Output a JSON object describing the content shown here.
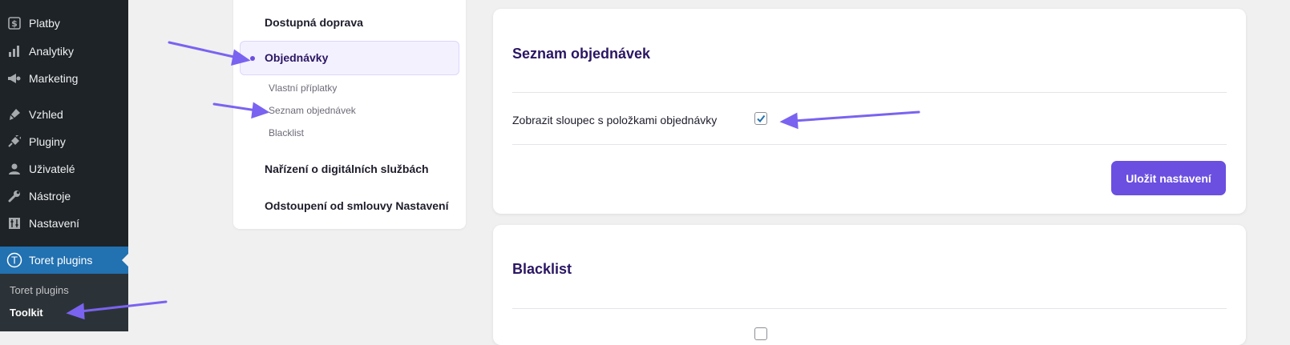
{
  "sidebar": {
    "items": [
      {
        "label": "Platby",
        "icon": "dollar-icon"
      },
      {
        "label": "Analytiky",
        "icon": "bar-chart-icon"
      },
      {
        "label": "Marketing",
        "icon": "megaphone-icon"
      },
      {
        "label": "Vzhled",
        "icon": "paintbrush-icon"
      },
      {
        "label": "Pluginy",
        "icon": "plug-icon"
      },
      {
        "label": "Uživatelé",
        "icon": "user-icon"
      },
      {
        "label": "Nástroje",
        "icon": "wrench-icon"
      },
      {
        "label": "Nastavení",
        "icon": "sliders-icon"
      }
    ],
    "active_item": {
      "label": "Toret plugins",
      "icon_letter": "T"
    },
    "submenu": [
      {
        "label": "Toret plugins",
        "current": false
      },
      {
        "label": "Toolkit",
        "current": true
      }
    ]
  },
  "settings_nav": {
    "items": [
      {
        "label": "Dostupná doprava"
      },
      {
        "label": "Objednávky",
        "active": true
      },
      {
        "label": "Nařízení o digitálních službách"
      },
      {
        "label": "Odstoupení od smlouvy Nastavení"
      }
    ],
    "subitems": [
      {
        "label": "Vlastní příplatky"
      },
      {
        "label": "Seznam objednávek"
      },
      {
        "label": "Blacklist"
      }
    ]
  },
  "orders_list_card": {
    "title": "Seznam objednávek",
    "checkbox_label": "Zobrazit sloupec s položkami objednávky",
    "checkbox_checked": true,
    "save_label": "Uložit nastavení"
  },
  "blacklist_card": {
    "title": "Blacklist"
  },
  "colors": {
    "sidebar_bg": "#1d2327",
    "sidebar_active": "#2271b1",
    "accent": "#6b4fe0",
    "title": "#2a1663",
    "annotation_arrow": "#7a63f0"
  }
}
